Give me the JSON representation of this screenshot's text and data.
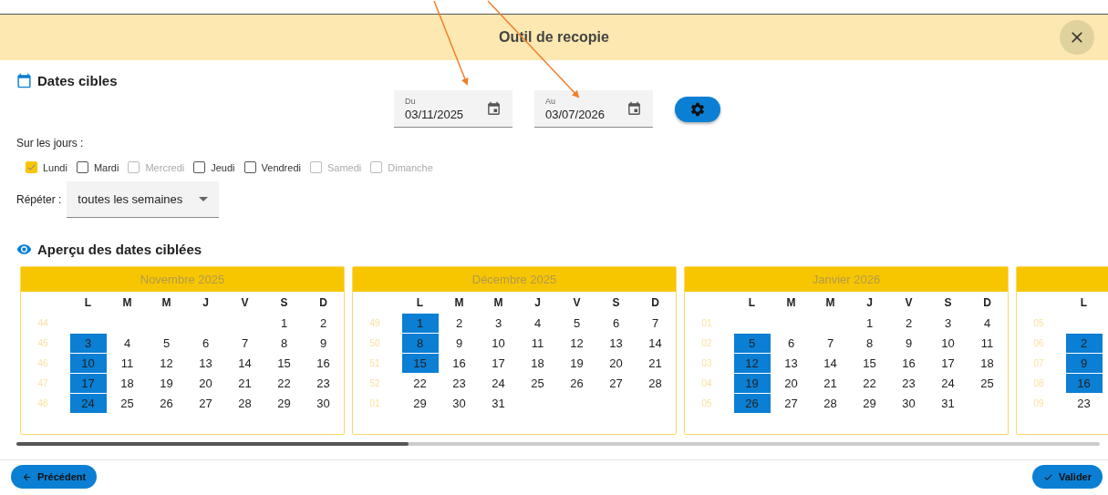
{
  "dialog": {
    "title": "Outil de recopie"
  },
  "targets": {
    "heading": "Dates cibles",
    "from": {
      "label": "Du",
      "value": "03/11/2025"
    },
    "to": {
      "label": "Au",
      "value": "03/07/2026"
    }
  },
  "days_label": "Sur les jours :",
  "days": [
    {
      "label": "Lundi",
      "checked": true,
      "disabled": false
    },
    {
      "label": "Mardi",
      "checked": false,
      "disabled": false
    },
    {
      "label": "Mercredi",
      "checked": false,
      "disabled": true
    },
    {
      "label": "Jeudi",
      "checked": false,
      "disabled": false
    },
    {
      "label": "Vendredi",
      "checked": false,
      "disabled": false
    },
    {
      "label": "Samedi",
      "checked": false,
      "disabled": true
    },
    {
      "label": "Dimanche",
      "checked": false,
      "disabled": true
    }
  ],
  "repeat": {
    "label": "Répéter :",
    "value": "toutes les semaines"
  },
  "preview": {
    "heading": "Aperçu des dates ciblées",
    "months": [
      {
        "title": "Novembre 2025",
        "headers": [
          "L",
          "M",
          "M",
          "J",
          "V",
          "S",
          "D"
        ],
        "weeks": [
          {
            "week": "44",
            "end_aligned": true,
            "days": [
              {
                "day": "1",
                "selected": false
              },
              {
                "day": "2",
                "selected": false
              }
            ]
          },
          {
            "week": "45",
            "days": [
              {
                "day": "3",
                "selected": true
              },
              {
                "day": "4",
                "selected": false
              },
              {
                "day": "5",
                "selected": false
              },
              {
                "day": "6",
                "selected": false
              },
              {
                "day": "7",
                "selected": false
              },
              {
                "day": "8",
                "selected": false
              },
              {
                "day": "9",
                "selected": false
              }
            ]
          },
          {
            "week": "46",
            "days": [
              {
                "day": "10",
                "selected": true
              },
              {
                "day": "11",
                "selected": false
              },
              {
                "day": "12",
                "selected": false
              },
              {
                "day": "13",
                "selected": false
              },
              {
                "day": "14",
                "selected": false
              },
              {
                "day": "15",
                "selected": false
              },
              {
                "day": "16",
                "selected": false
              }
            ]
          },
          {
            "week": "47",
            "days": [
              {
                "day": "17",
                "selected": true
              },
              {
                "day": "18",
                "selected": false
              },
              {
                "day": "19",
                "selected": false
              },
              {
                "day": "20",
                "selected": false
              },
              {
                "day": "21",
                "selected": false
              },
              {
                "day": "22",
                "selected": false
              },
              {
                "day": "23",
                "selected": false
              }
            ]
          },
          {
            "week": "48",
            "days": [
              {
                "day": "24",
                "selected": true
              },
              {
                "day": "25",
                "selected": false
              },
              {
                "day": "26",
                "selected": false
              },
              {
                "day": "27",
                "selected": false
              },
              {
                "day": "28",
                "selected": false
              },
              {
                "day": "29",
                "selected": false
              },
              {
                "day": "30",
                "selected": false
              }
            ]
          }
        ]
      },
      {
        "title": "Décembre 2025",
        "headers": [
          "L",
          "M",
          "M",
          "J",
          "V",
          "S",
          "D"
        ],
        "weeks": [
          {
            "week": "49",
            "days": [
              {
                "day": "1",
                "selected": true
              },
              {
                "day": "2",
                "selected": false
              },
              {
                "day": "3",
                "selected": false
              },
              {
                "day": "4",
                "selected": false
              },
              {
                "day": "5",
                "selected": false
              },
              {
                "day": "6",
                "selected": false
              },
              {
                "day": "7",
                "selected": false
              }
            ]
          },
          {
            "week": "50",
            "days": [
              {
                "day": "8",
                "selected": true
              },
              {
                "day": "9",
                "selected": false
              },
              {
                "day": "10",
                "selected": false
              },
              {
                "day": "11",
                "selected": false
              },
              {
                "day": "12",
                "selected": false
              },
              {
                "day": "13",
                "selected": false
              },
              {
                "day": "14",
                "selected": false
              }
            ]
          },
          {
            "week": "51",
            "days": [
              {
                "day": "15",
                "selected": true
              },
              {
                "day": "16",
                "selected": false
              },
              {
                "day": "17",
                "selected": false
              },
              {
                "day": "18",
                "selected": false
              },
              {
                "day": "19",
                "selected": false
              },
              {
                "day": "20",
                "selected": false
              },
              {
                "day": "21",
                "selected": false
              }
            ]
          },
          {
            "week": "52",
            "days": [
              {
                "day": "22",
                "selected": false
              },
              {
                "day": "23",
                "selected": false
              },
              {
                "day": "24",
                "selected": false
              },
              {
                "day": "25",
                "selected": false
              },
              {
                "day": "26",
                "selected": false
              },
              {
                "day": "27",
                "selected": false
              },
              {
                "day": "28",
                "selected": false
              }
            ]
          },
          {
            "week": "01",
            "days": [
              {
                "day": "29",
                "selected": false
              },
              {
                "day": "30",
                "selected": false
              },
              {
                "day": "31",
                "selected": false
              }
            ]
          }
        ]
      },
      {
        "title": "Janvier 2026",
        "headers": [
          "L",
          "M",
          "M",
          "J",
          "V",
          "S",
          "D"
        ],
        "weeks": [
          {
            "week": "01",
            "end_aligned": true,
            "days": [
              {
                "day": "1",
                "selected": false
              },
              {
                "day": "2",
                "selected": false
              },
              {
                "day": "3",
                "selected": false
              },
              {
                "day": "4",
                "selected": false
              }
            ]
          },
          {
            "week": "02",
            "days": [
              {
                "day": "5",
                "selected": true
              },
              {
                "day": "6",
                "selected": false
              },
              {
                "day": "7",
                "selected": false
              },
              {
                "day": "8",
                "selected": false
              },
              {
                "day": "9",
                "selected": false
              },
              {
                "day": "10",
                "selected": false
              },
              {
                "day": "11",
                "selected": false
              }
            ]
          },
          {
            "week": "03",
            "days": [
              {
                "day": "12",
                "selected": true
              },
              {
                "day": "13",
                "selected": false
              },
              {
                "day": "14",
                "selected": false
              },
              {
                "day": "15",
                "selected": false
              },
              {
                "day": "16",
                "selected": false
              },
              {
                "day": "17",
                "selected": false
              },
              {
                "day": "18",
                "selected": false
              }
            ]
          },
          {
            "week": "04",
            "days": [
              {
                "day": "19",
                "selected": true
              },
              {
                "day": "20",
                "selected": false
              },
              {
                "day": "21",
                "selected": false
              },
              {
                "day": "22",
                "selected": false
              },
              {
                "day": "23",
                "selected": false
              },
              {
                "day": "24",
                "selected": false
              },
              {
                "day": "25",
                "selected": false
              }
            ]
          },
          {
            "week": "05",
            "days": [
              {
                "day": "26",
                "selected": true
              },
              {
                "day": "27",
                "selected": false
              },
              {
                "day": "28",
                "selected": false
              },
              {
                "day": "29",
                "selected": false
              },
              {
                "day": "30",
                "selected": false
              },
              {
                "day": "31",
                "selected": false
              }
            ]
          }
        ]
      },
      {
        "headers": [
          "L"
        ],
        "weeks": [
          {
            "week": "05"
          },
          {
            "week": "06",
            "days": [
              {
                "day": "2",
                "selected": true
              }
            ]
          },
          {
            "week": "07",
            "days": [
              {
                "day": "9",
                "selected": true
              }
            ]
          },
          {
            "week": "08",
            "days": [
              {
                "day": "16",
                "selected": true
              }
            ]
          },
          {
            "week": "09",
            "days": [
              {
                "day": "23",
                "selected": false
              }
            ]
          }
        ]
      }
    ]
  },
  "footer": {
    "back": "Précédent",
    "submit": "Valider"
  }
}
